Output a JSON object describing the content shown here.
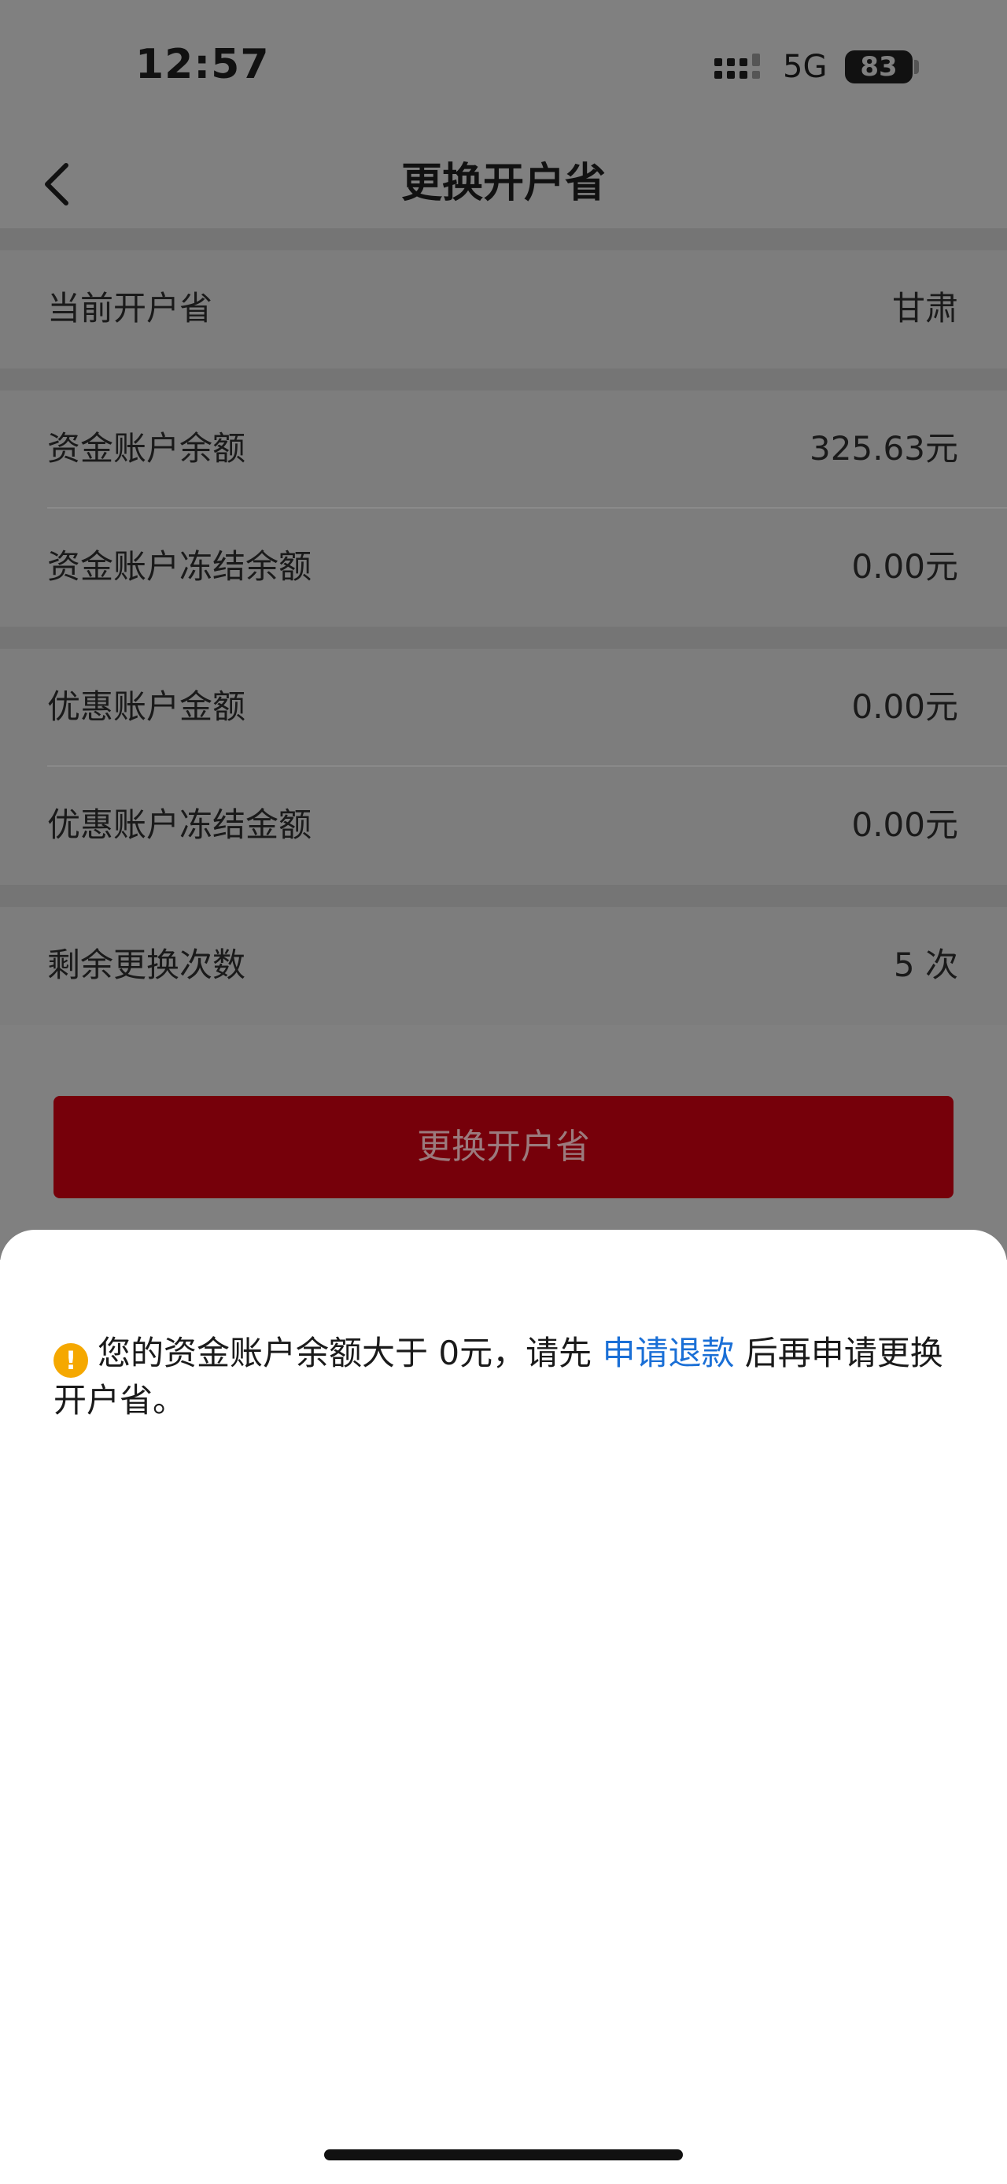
{
  "status_bar": {
    "time": "12:57",
    "network": "5G",
    "battery": "83"
  },
  "nav": {
    "title": "更换开户省",
    "back_icon": "chevron-left-icon"
  },
  "info": {
    "current_province_label": "当前开户省",
    "current_province_value": "甘肃"
  },
  "balances": {
    "fund_balance_label": "资金账户余额",
    "fund_balance_value": "325.63元",
    "fund_frozen_label": "资金账户冻结余额",
    "fund_frozen_value": "0.00元"
  },
  "discount": {
    "discount_amount_label": "优惠账户金额",
    "discount_amount_value": "0.00元",
    "discount_frozen_label": "优惠账户冻结金额",
    "discount_frozen_value": "0.00元"
  },
  "changes": {
    "remaining_label": "剩余更换次数",
    "remaining_value": "5 次"
  },
  "action": {
    "button_label": "更换开户省"
  },
  "sheet": {
    "warning_icon": "warning-icon",
    "warning_glyph": "!",
    "text_before": "您的资金账户余额大于 0元，请先 ",
    "link_text": "申请退款",
    "text_after": " 后再申请更换开户省。"
  },
  "colors": {
    "overlay_gray": "#808080",
    "primary_dimmed": "#76000a",
    "link_blue": "#1a6fd6",
    "warning_amber": "#f5a800"
  }
}
